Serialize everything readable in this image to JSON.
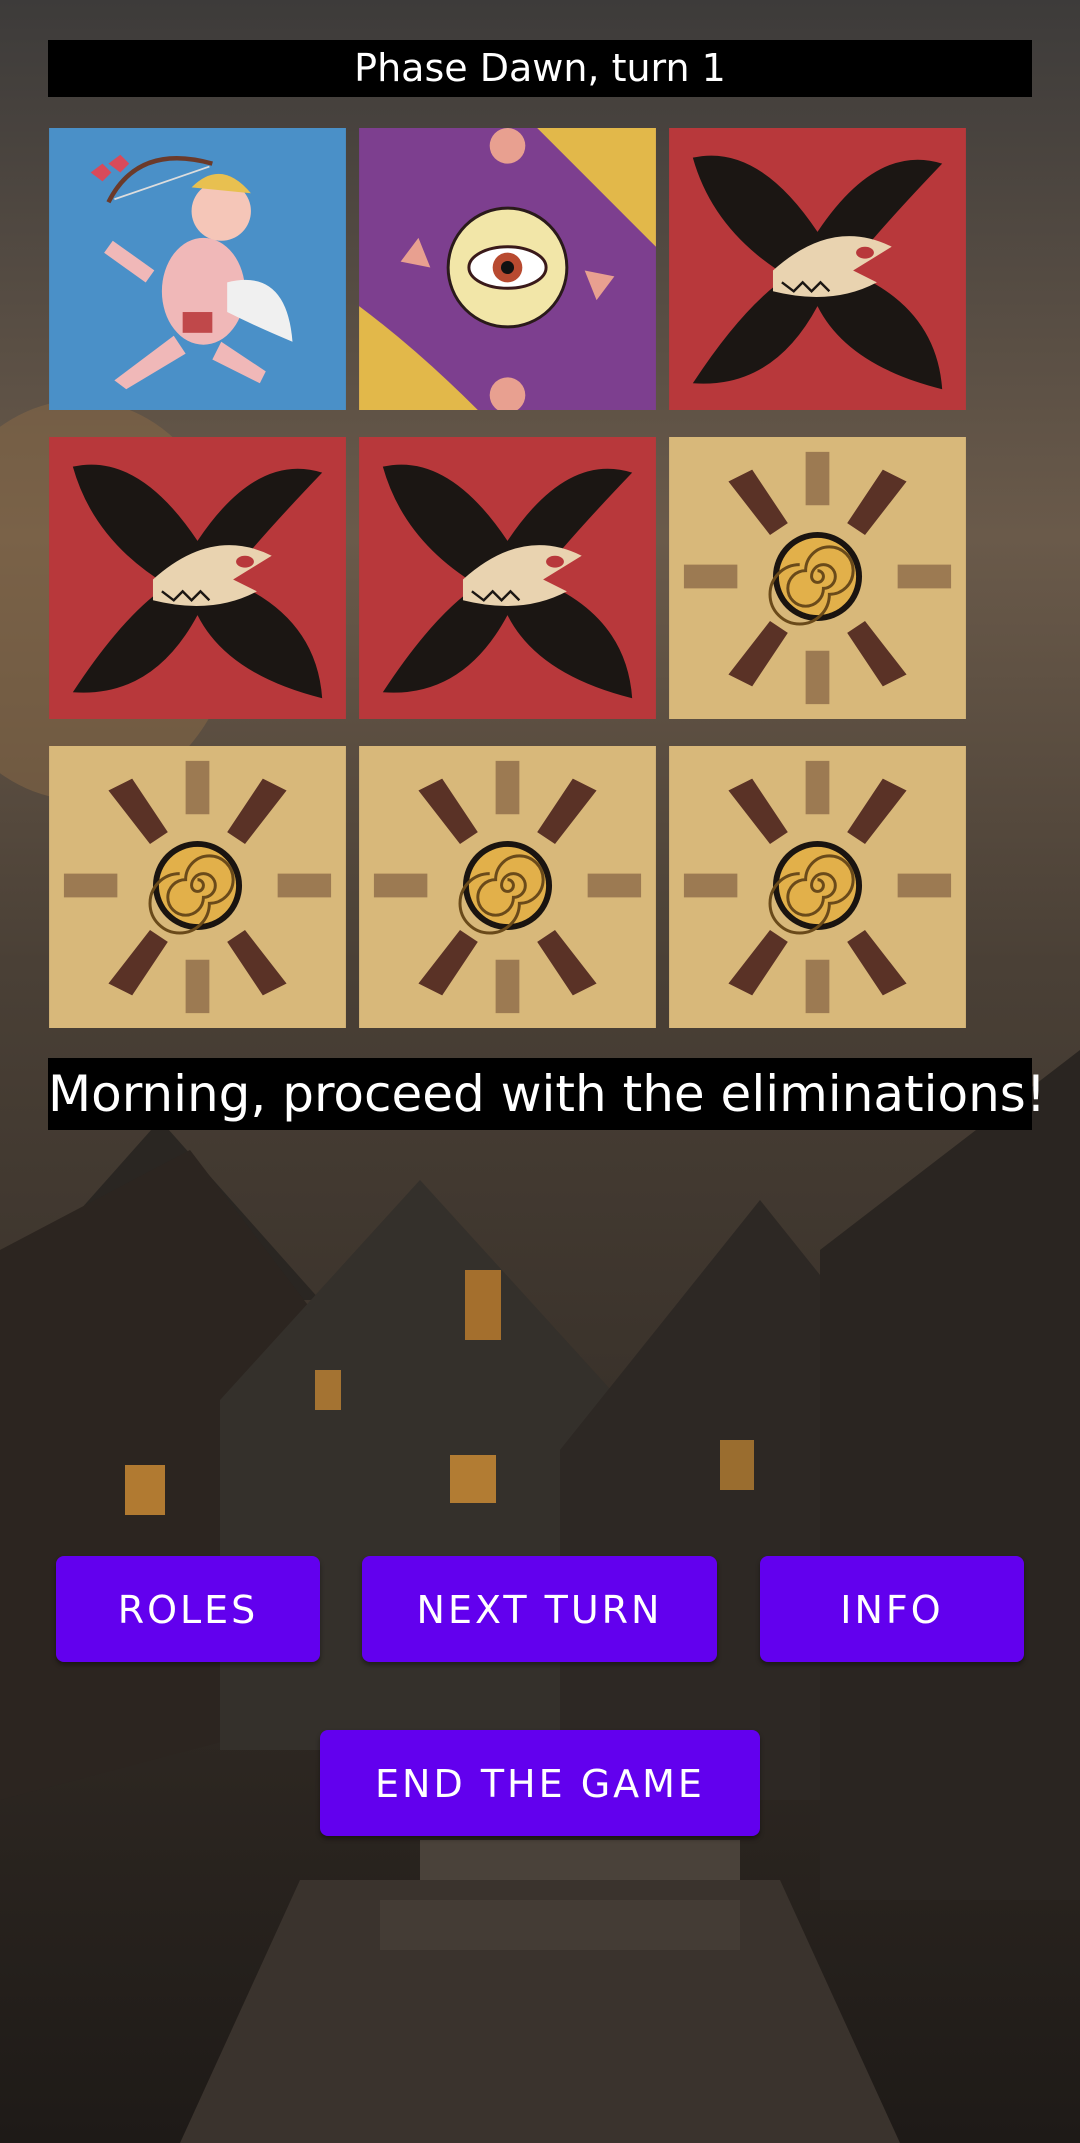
{
  "header": {
    "phase_text": "Phase Dawn, turn 1"
  },
  "board": {
    "cards": [
      {
        "role": "cupid",
        "icon": "cupid-card-icon"
      },
      {
        "role": "seer",
        "icon": "seer-eye-card-icon"
      },
      {
        "role": "werewolf",
        "icon": "werewolf-card-icon"
      },
      {
        "role": "werewolf",
        "icon": "werewolf-card-icon"
      },
      {
        "role": "werewolf",
        "icon": "werewolf-card-icon"
      },
      {
        "role": "villager",
        "icon": "villager-spiral-card-icon"
      },
      {
        "role": "villager",
        "icon": "villager-spiral-card-icon"
      },
      {
        "role": "villager",
        "icon": "villager-spiral-card-icon"
      },
      {
        "role": "villager",
        "icon": "villager-spiral-card-icon"
      }
    ]
  },
  "message": {
    "text": "Morning, proceed with the eliminations!"
  },
  "buttons": {
    "roles": "ROLES",
    "next_turn": "NEXT TURN",
    "info": "INFO",
    "end_game": "END THE GAME"
  },
  "colors": {
    "button": "#6200ee",
    "bar_background": "#000000",
    "werewolf_red": "#b8383b",
    "villager_tan": "#d8b87a",
    "cupid_blue": "#4a90c8",
    "seer_purple": "#7d3f8f"
  }
}
